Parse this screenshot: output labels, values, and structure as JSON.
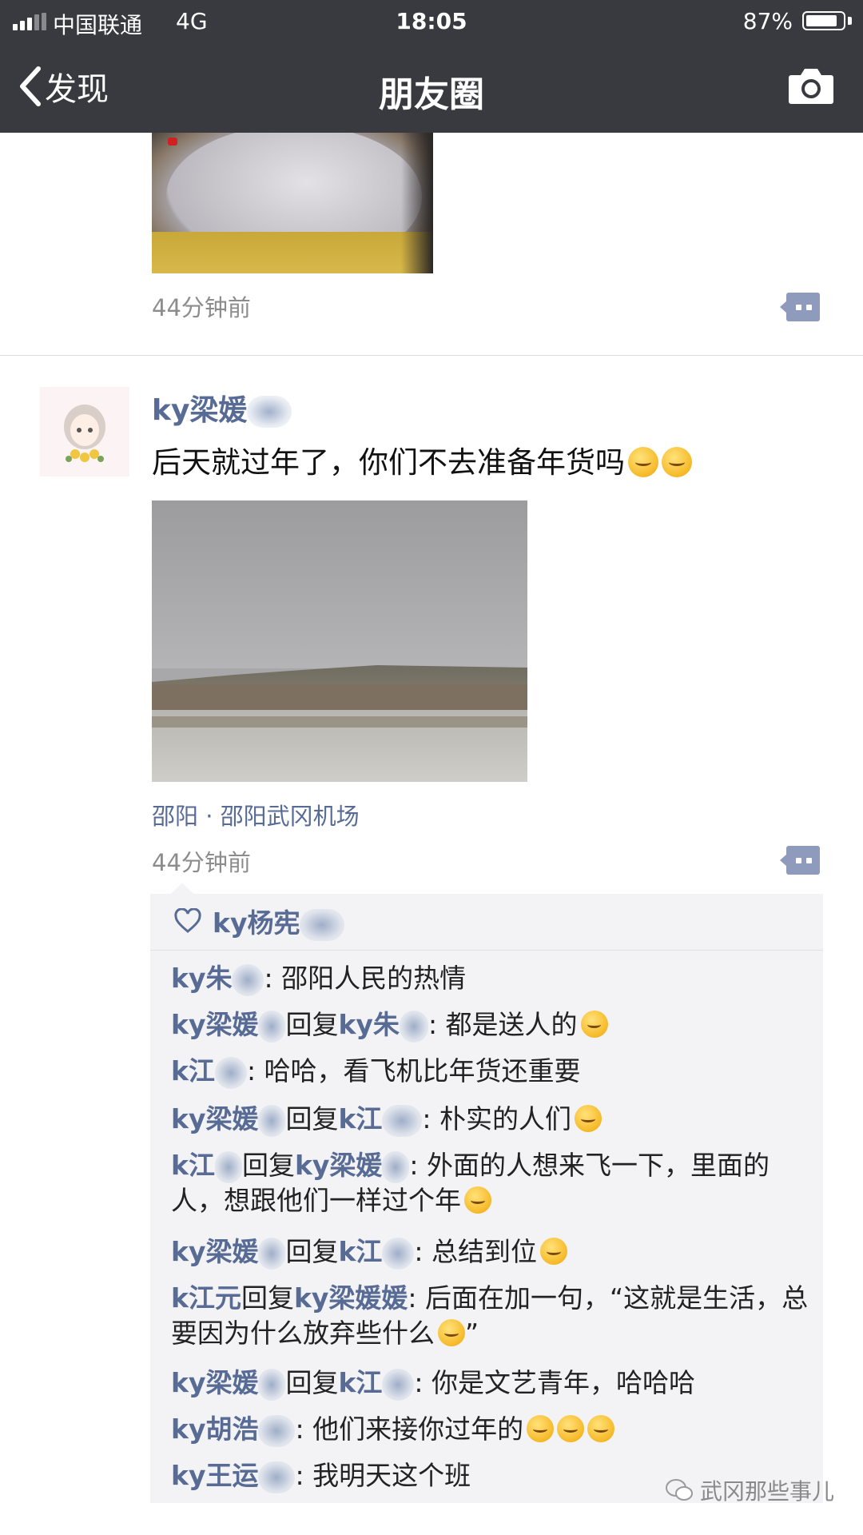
{
  "status_bar": {
    "carrier": "中国联通",
    "network": "4G",
    "time": "18:05",
    "battery_text": "87%",
    "battery_level": 0.87
  },
  "nav": {
    "back_label": "发现",
    "title": "朋友圈",
    "back_icon": "chevron-left-icon",
    "camera_icon": "camera-icon"
  },
  "posts": [
    {
      "time": "44分钟前"
    },
    {
      "author": "ky梁媛",
      "text": "后天就过年了，你们不去准备年货吗",
      "location": "邵阳 · 邵阳武冈机场",
      "time": "44分钟前",
      "likes": [
        "ky杨宪"
      ],
      "comments": [
        {
          "author": "ky朱",
          "text": ": 邵阳人民的热情"
        },
        {
          "author": "ky梁媛",
          "reply_word": "回复",
          "reply_to": "ky朱",
          "text": ": 都是送人的"
        },
        {
          "author": "k江",
          "text": ": 哈哈，看飞机比年货还重要"
        },
        {
          "author": "ky梁媛",
          "reply_word": "回复",
          "reply_to": "k江",
          "text": ": 朴实的人们"
        },
        {
          "author": "k江",
          "reply_word": "回复",
          "reply_to": "ky梁媛",
          "text": ": 外面的人想来飞一下，里面的人，想跟他们一样过个年"
        },
        {
          "author": "ky梁媛",
          "reply_word": "回复",
          "reply_to": "k江",
          "text": ": 总结到位"
        },
        {
          "author": "k江元",
          "reply_word": "回复",
          "reply_to": "ky梁媛媛",
          "text": ": 后面在加一句，“这就是生活，总要因为什么放弃些什么",
          "tail": "”"
        },
        {
          "author": "ky梁媛",
          "reply_word": "回复",
          "reply_to": "k江",
          "text": ": 你是文艺青年，哈哈哈"
        },
        {
          "author": "ky胡浩",
          "text": ": 他们来接你过年的"
        },
        {
          "author": "ky王运",
          "text": ": 我明天这个班"
        }
      ]
    }
  ],
  "watermark": "武冈那些事儿",
  "colors": {
    "nav_bg": "#393a3f",
    "name_link": "#576b95",
    "comment_bg": "#f3f3f5",
    "time_gray": "#8c8c8c"
  }
}
